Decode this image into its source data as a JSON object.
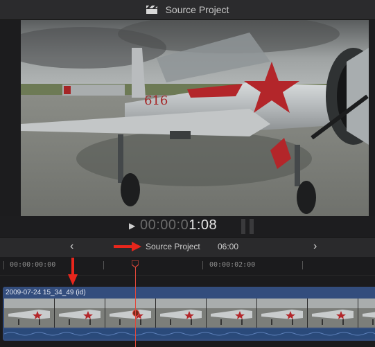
{
  "window": {
    "title": "Source Project"
  },
  "viewer": {
    "scene": "silver propeller aircraft with red stars on airfield"
  },
  "timecode": {
    "dim": "00:00:0",
    "bright": "1:08"
  },
  "timeline_nav": {
    "project_name": "Source Project",
    "duration": "06:00"
  },
  "ruler": {
    "labels": [
      "00:00:00:00",
      "00:00:02:00"
    ]
  },
  "clip": {
    "name": "2009-07-24 15_34_49 (id)",
    "thumbnail_count": 8
  },
  "colors": {
    "playhead": "#e0483b",
    "annotation_arrow": "#e8261c",
    "clip_blue": "#334d7d"
  },
  "icons": {
    "title_icon": "clapperboard-icon",
    "play": "play-icon",
    "prev": "chevron-left-icon",
    "next": "chevron-right-icon"
  }
}
